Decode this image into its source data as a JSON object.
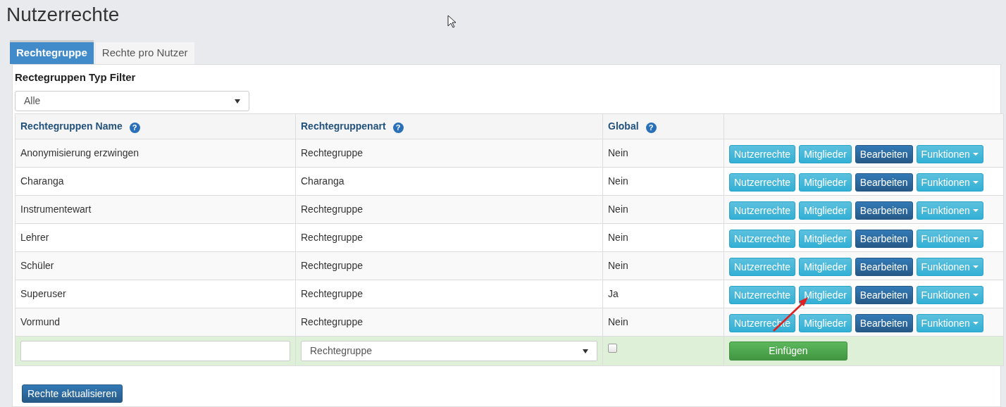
{
  "page": {
    "title": "Nutzerrechte"
  },
  "tabs": [
    {
      "label": "Rechtegruppe",
      "selected": true
    },
    {
      "label": "Rechte pro Nutzer",
      "selected": false
    }
  ],
  "filter": {
    "label": "Rectegruppen Typ Filter",
    "value": "Alle"
  },
  "table": {
    "columns": [
      {
        "label": "Rechtegruppen Name",
        "help": "?"
      },
      {
        "label": "Rechtegruppenart",
        "help": "?"
      },
      {
        "label": "Global",
        "help": "?"
      }
    ],
    "rows": [
      {
        "name": "Anonymisierung erzwingen",
        "type": "Rechtegruppe",
        "global": "Nein",
        "buttons": [
          {
            "label": "Nutzerrechte",
            "kind": "info"
          },
          {
            "label": "Mitglieder",
            "kind": "info"
          },
          {
            "label": "Bearbeiten",
            "kind": "primary"
          },
          {
            "label": "Funktionen",
            "kind": "dropdown"
          }
        ]
      },
      {
        "name": "Charanga",
        "type": "Charanga",
        "global": "Nein",
        "buttons": [
          {
            "label": "Nutzerrechte",
            "kind": "info"
          },
          {
            "label": "Mitglieder",
            "kind": "info"
          },
          {
            "label": "Bearbeiten",
            "kind": "primary"
          },
          {
            "label": "Funktionen",
            "kind": "dropdown"
          }
        ]
      },
      {
        "name": "Instrumentewart",
        "type": "Rechtegruppe",
        "global": "Nein",
        "buttons": [
          {
            "label": "Nutzerrechte",
            "kind": "info"
          },
          {
            "label": "Mitglieder",
            "kind": "info"
          },
          {
            "label": "Bearbeiten",
            "kind": "primary"
          },
          {
            "label": "Funktionen",
            "kind": "dropdown"
          }
        ]
      },
      {
        "name": "Lehrer",
        "type": "Rechtegruppe",
        "global": "Nein",
        "buttons": [
          {
            "label": "Nutzerrechte",
            "kind": "info"
          },
          {
            "label": "Mitglieder",
            "kind": "info"
          },
          {
            "label": "Bearbeiten",
            "kind": "primary"
          },
          {
            "label": "Funktionen",
            "kind": "dropdown"
          }
        ]
      },
      {
        "name": "Schüler",
        "type": "Rechtegruppe",
        "global": "Nein",
        "buttons": [
          {
            "label": "Nutzerrechte",
            "kind": "info"
          },
          {
            "label": "Mitglieder",
            "kind": "info"
          },
          {
            "label": "Bearbeiten",
            "kind": "primary"
          },
          {
            "label": "Funktionen",
            "kind": "dropdown"
          }
        ]
      },
      {
        "name": "Superuser",
        "type": "Rechtegruppe",
        "global": "Ja",
        "buttons": [
          {
            "label": "Nutzerrechte",
            "kind": "info"
          },
          {
            "label": "Mitglieder",
            "kind": "info"
          },
          {
            "label": "Bearbeiten",
            "kind": "primary"
          },
          {
            "label": "Funktionen",
            "kind": "dropdown"
          }
        ]
      },
      {
        "name": "Vormund",
        "type": "Rechtegruppe",
        "global": "Nein",
        "buttons": [
          {
            "label": "Nutzerrechte",
            "kind": "info"
          },
          {
            "label": "Mitglieder",
            "kind": "info"
          },
          {
            "label": "Bearbeiten",
            "kind": "primary"
          },
          {
            "label": "Funktionen",
            "kind": "dropdown"
          }
        ]
      }
    ],
    "new_row": {
      "type_value": "Rechtegruppe",
      "global_checked": false,
      "button": "Einfügen"
    }
  },
  "footer_button": "Rechte aktualisieren"
}
